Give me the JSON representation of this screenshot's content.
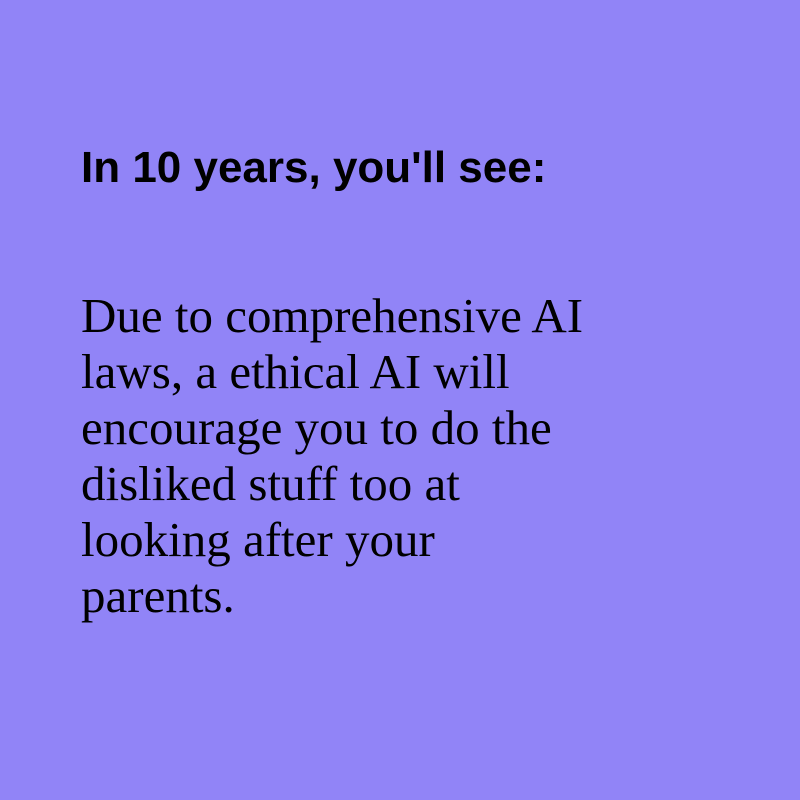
{
  "background_color": "#9184F7",
  "text_color": "#000000",
  "headline": "In 10 years, you'll see:",
  "body": {
    "lines": [
      "Due to comprehensive AI",
      "laws, a ethical AI will",
      "encourage you to do the",
      "disliked stuff too at",
      "looking after your",
      "parents."
    ]
  }
}
